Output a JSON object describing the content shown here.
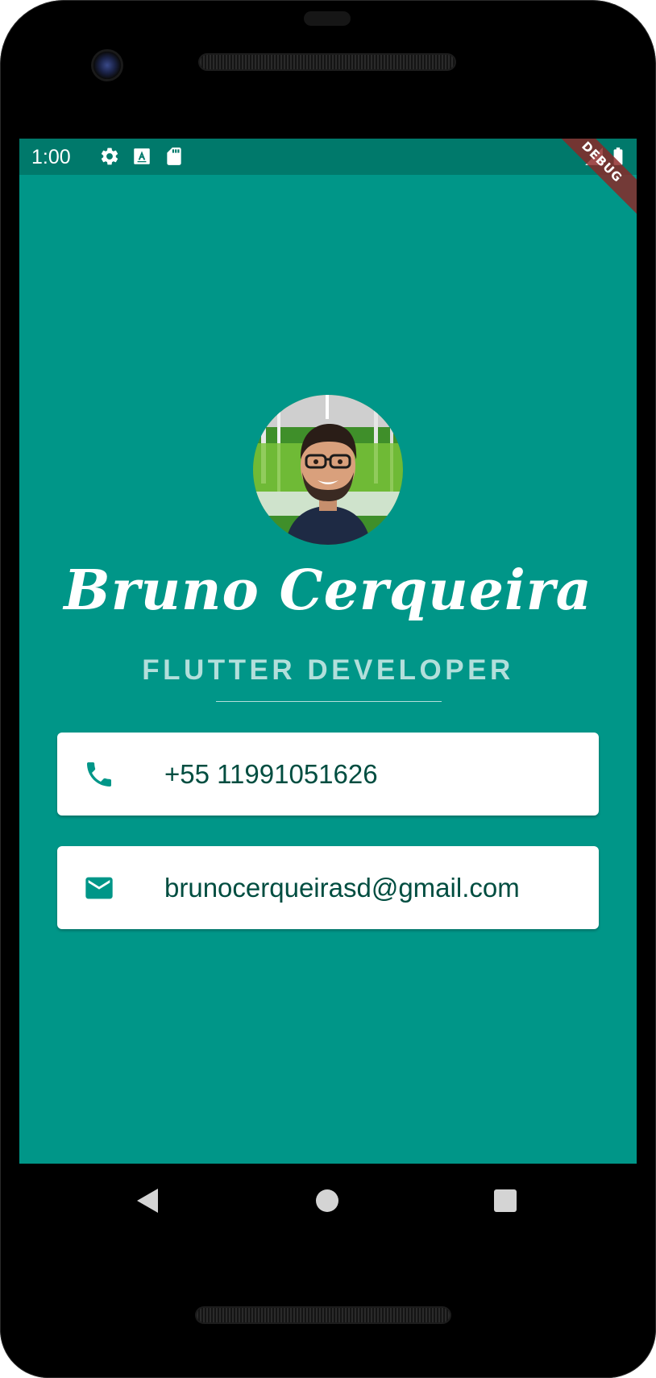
{
  "status_bar": {
    "time": "1:00",
    "left_icons": [
      "gear-icon",
      "a-keyboard-icon",
      "sd-card-icon"
    ],
    "right_icons": [
      "signal-icon",
      "battery-icon"
    ]
  },
  "debug_banner": "DEBUG",
  "profile": {
    "name": "Bruno Cerqueira",
    "title": "FLUTTER DEVELOPER",
    "avatar_icon": "profile-photo"
  },
  "contacts": {
    "phone": {
      "icon": "phone-icon",
      "text": "+55 11991051626"
    },
    "email": {
      "icon": "mail-icon",
      "text": "brunocerqueirasd@gmail.com"
    }
  },
  "navigation": {
    "icons": [
      "back-icon",
      "home-icon",
      "recents-icon"
    ]
  },
  "colors": {
    "background": "#009688",
    "status_bar": "#00796B",
    "subtitle": "#B2DFDB",
    "card_text": "#004D40",
    "card_icon": "#009688",
    "debug_banner": "#8C2626"
  }
}
